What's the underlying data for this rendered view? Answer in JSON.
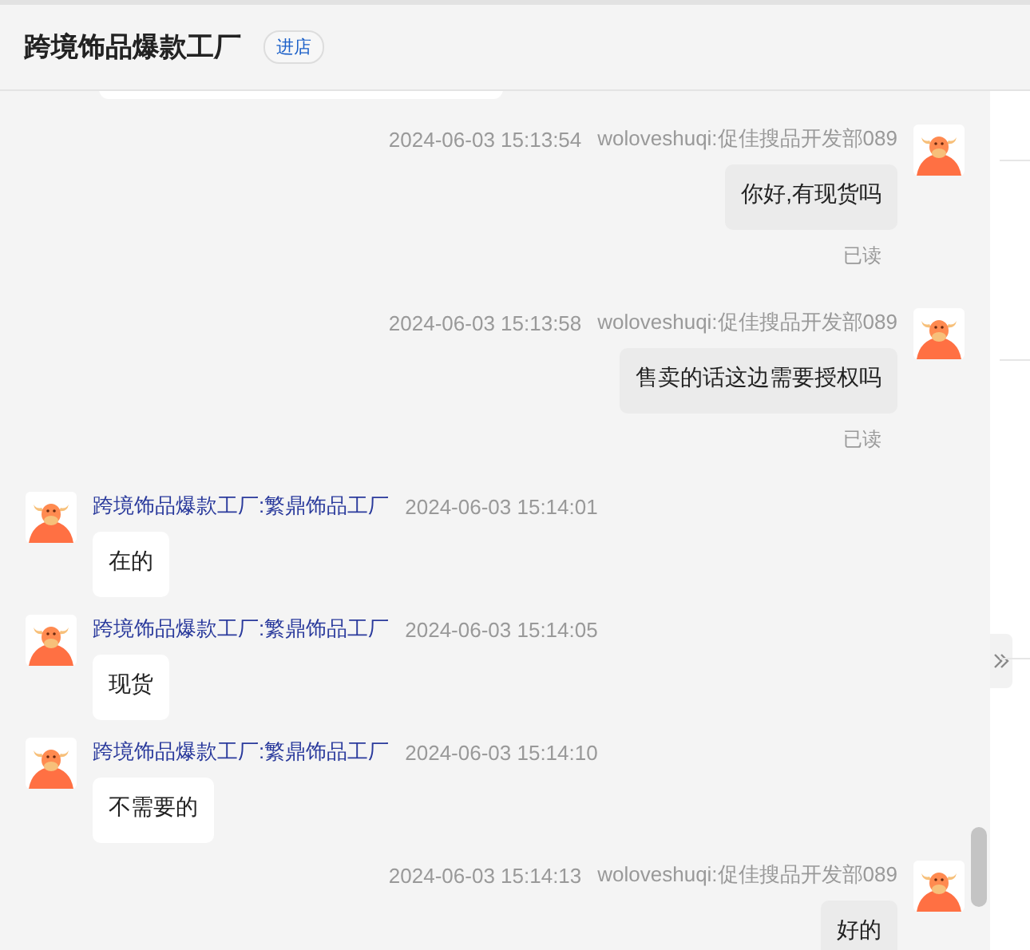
{
  "header": {
    "title": "跨境饰品爆款工厂",
    "enter_store": "进店"
  },
  "messages": [
    {
      "kind": "outgoing",
      "time": "2024-06-03 15:13:54",
      "sender": "woloveshuqi:促佳搜品开发部089",
      "text": "你好,有现货吗",
      "read_status": "已读"
    },
    {
      "kind": "outgoing",
      "time": "2024-06-03 15:13:58",
      "sender": "woloveshuqi:促佳搜品开发部089",
      "text": "售卖的话这边需要授权吗",
      "read_status": "已读"
    },
    {
      "kind": "incoming",
      "sender": "跨境饰品爆款工厂:繁鼎饰品工厂",
      "time": "2024-06-03 15:14:01",
      "text": "在的"
    },
    {
      "kind": "incoming",
      "sender": "跨境饰品爆款工厂:繁鼎饰品工厂",
      "time": "2024-06-03 15:14:05",
      "text": "现货"
    },
    {
      "kind": "incoming",
      "sender": "跨境饰品爆款工厂:繁鼎饰品工厂",
      "time": "2024-06-03 15:14:10",
      "text": "不需要的"
    },
    {
      "kind": "outgoing",
      "time": "2024-06-03 15:14:13",
      "sender": "woloveshuqi:促佳搜品开发部089",
      "text": "好的"
    }
  ]
}
